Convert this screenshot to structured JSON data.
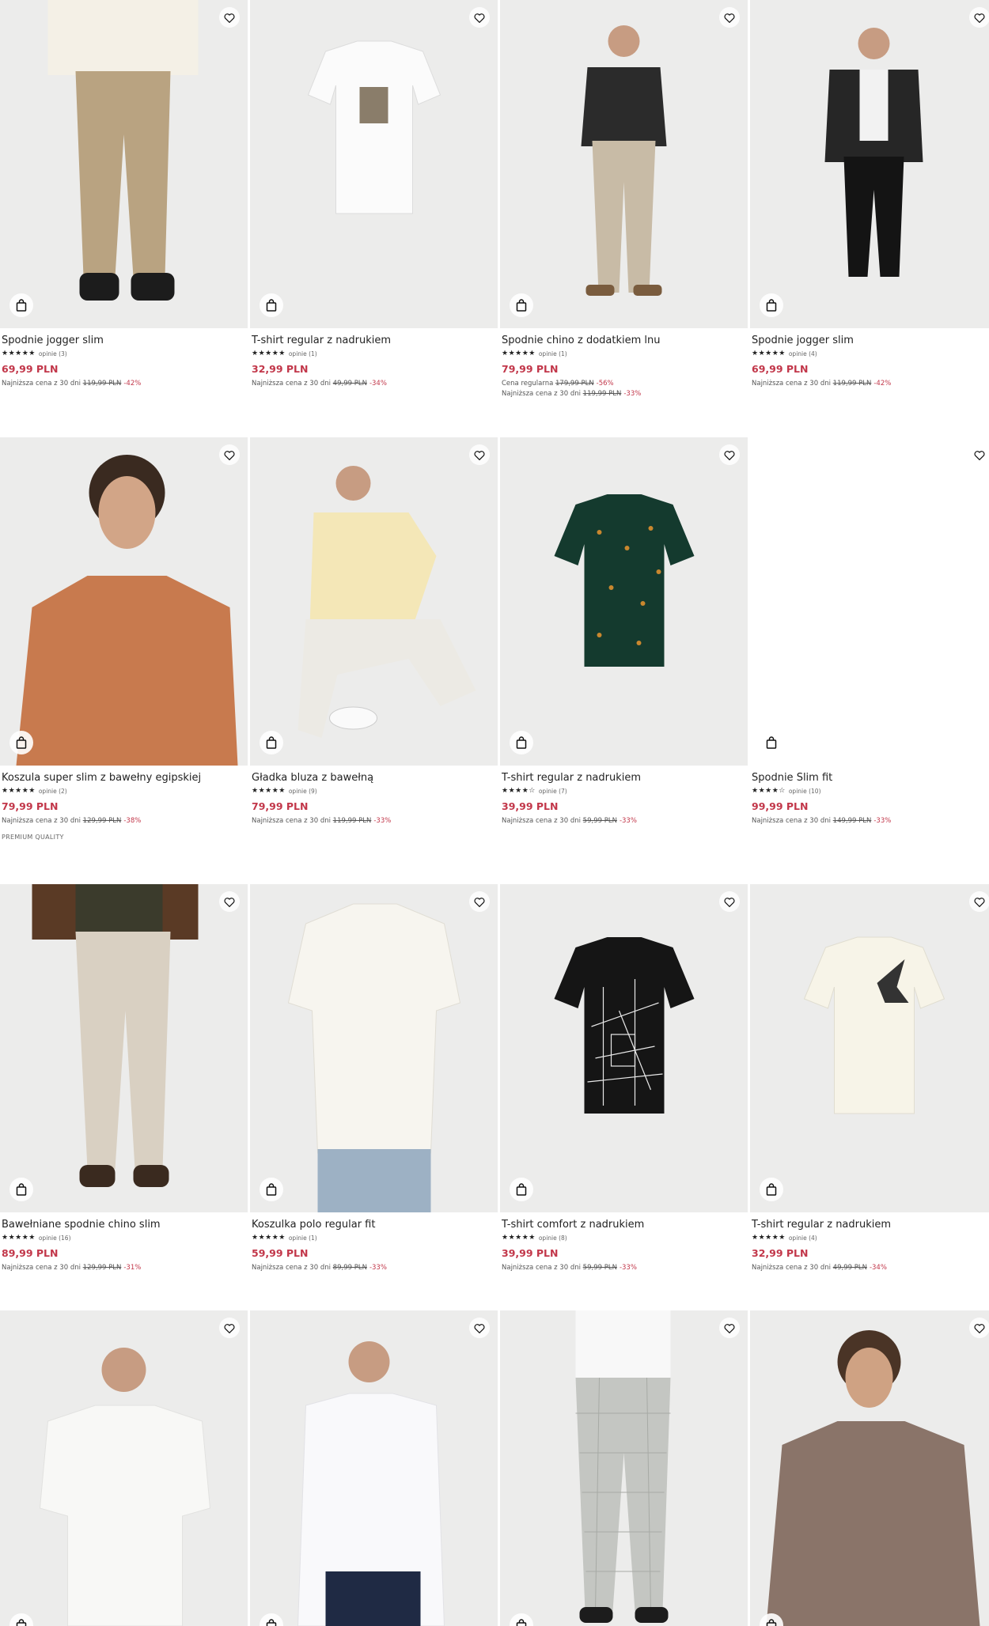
{
  "common": {
    "reviews_prefix": "opinie"
  },
  "products": [
    {
      "name": "Spodnie jogger slim",
      "stars": "★★★★★",
      "reviews": "opinie (3)",
      "price": "69,99 PLN",
      "lowest_label": "Najniższa cena z 30 dni",
      "lowest_old": "119,99 PLN",
      "lowest_discount": "-42%"
    },
    {
      "name": "T-shirt regular z nadrukiem",
      "stars": "★★★★★",
      "reviews": "opinie (1)",
      "price": "32,99 PLN",
      "lowest_label": "Najniższa cena z 30 dni",
      "lowest_old": "49,99 PLN",
      "lowest_discount": "-34%"
    },
    {
      "name": "Spodnie chino z dodatkiem lnu",
      "stars": "★★★★★",
      "reviews": "opinie (1)",
      "price": "79,99 PLN",
      "regular_label": "Cena regularna",
      "regular_old": "179,99 PLN",
      "regular_discount": "-56%",
      "lowest_label": "Najniższa cena z 30 dni",
      "lowest_old": "119,99 PLN",
      "lowest_discount": "-33%"
    },
    {
      "name": "Spodnie jogger slim",
      "stars": "★★★★★",
      "reviews": "opinie (4)",
      "price": "69,99 PLN",
      "lowest_label": "Najniższa cena z 30 dni",
      "lowest_old": "119,99 PLN",
      "lowest_discount": "-42%"
    },
    {
      "name": "Koszula super slim z bawełny egipskiej",
      "stars": "★★★★★",
      "reviews": "opinie (2)",
      "price": "79,99 PLN",
      "lowest_label": "Najniższa cena z 30 dni",
      "lowest_old": "129,99 PLN",
      "lowest_discount": "-38%",
      "badge": "PREMIUM QUALITY"
    },
    {
      "name": "Gładka bluza z bawełną",
      "stars": "★★★★★",
      "reviews": "opinie (9)",
      "price": "79,99 PLN",
      "lowest_label": "Najniższa cena z 30 dni",
      "lowest_old": "119,99 PLN",
      "lowest_discount": "-33%"
    },
    {
      "name": "T-shirt regular z nadrukiem",
      "stars": "★★★★☆",
      "reviews": "opinie (7)",
      "price": "39,99 PLN",
      "lowest_label": "Najniższa cena z 30 dni",
      "lowest_old": "59,99 PLN",
      "lowest_discount": "-33%"
    },
    {
      "name": "Spodnie Slim fit",
      "stars": "★★★★☆",
      "reviews": "opinie (10)",
      "price": "99,99 PLN",
      "lowest_label": "Najniższa cena z 30 dni",
      "lowest_old": "149,99 PLN",
      "lowest_discount": "-33%"
    },
    {
      "name": "Bawełniane spodnie chino slim",
      "stars": "★★★★★",
      "reviews": "opinie (16)",
      "price": "89,99 PLN",
      "lowest_label": "Najniższa cena z 30 dni",
      "lowest_old": "129,99 PLN",
      "lowest_discount": "-31%"
    },
    {
      "name": "Koszulka polo regular fit",
      "stars": "★★★★★",
      "reviews": "opinie (1)",
      "price": "59,99 PLN",
      "lowest_label": "Najniższa cena z 30 dni",
      "lowest_old": "89,99 PLN",
      "lowest_discount": "-33%"
    },
    {
      "name": "T-shirt comfort z nadrukiem",
      "stars": "★★★★★",
      "reviews": "opinie (8)",
      "price": "39,99 PLN",
      "lowest_label": "Najniższa cena z 30 dni",
      "lowest_old": "59,99 PLN",
      "lowest_discount": "-33%"
    },
    {
      "name": "T-shirt regular z nadrukiem",
      "stars": "★★★★★",
      "reviews": "opinie (4)",
      "price": "32,99 PLN",
      "lowest_label": "Najniższa cena z 30 dni",
      "lowest_old": "49,99 PLN",
      "lowest_discount": "-34%"
    }
  ],
  "colors": {
    "sale": "#c2374a",
    "image_bg": "#ececeb",
    "text": "#222222"
  },
  "icons": {
    "wishlist": "heart-icon",
    "add_to_cart": "shopping-bag-icon"
  }
}
